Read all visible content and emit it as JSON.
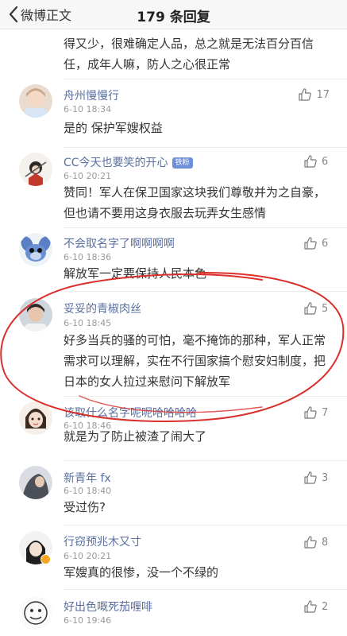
{
  "header": {
    "back_label": "微博正文",
    "title": "179 条回复"
  },
  "top_comment_text": "得又少，很难确定人品，总之就是无法百分百信任，成年人嘛，防人之心很正常",
  "comments": [
    {
      "name": "舟州慢慢行",
      "time": "6-10 18:34",
      "likes": "17",
      "text": "是的 保护军嫂权益"
    },
    {
      "name": "CC今天也要笑的开心",
      "badge": "铁粉",
      "time": "6-10 20:21",
      "likes": "6",
      "text": "赞同！军人在保卫国家这块我们尊敬并为之自豪，但也请不要用这身衣服去玩弄女生感情"
    },
    {
      "name": "不会取名字了啊啊啊啊",
      "time": "6-10 18:36",
      "likes": "6",
      "text": "解放军一定要保持人民本色"
    },
    {
      "name": "妥妥的青椒肉丝",
      "time": "6-10 18:45",
      "likes": "5",
      "text": "好多当兵的骚的可怕，毫不掩饰的那种，军人正常需求可以理解，实在不行国家搞个慰安妇制度，把日本的女人拉过来慰问下解放军"
    },
    {
      "name": "该取什么名字呢呢哈哈哈哈",
      "time": "6-10 18:46",
      "likes": "7",
      "text": "就是为了防止被渣了闹大了"
    },
    {
      "name": "新青年 fx",
      "time": "6-10 18:40",
      "likes": "3",
      "text": "受过伤?"
    },
    {
      "name": "行窃预兆木又寸",
      "time": "6-10 20:21",
      "likes": "8",
      "text": "军嫂真的很惨，没一个不绿的"
    },
    {
      "name": "好出色嘅死茄喱啡",
      "time": "6-10 19:46",
      "likes": "2",
      "text": ""
    }
  ],
  "icons": {
    "back": "chevron-left-icon",
    "like": "thumbs-up-icon"
  },
  "colors": {
    "username": "#5a6fa0",
    "annotation_circle": "#d9302c",
    "fan_badge": "#6f8fd8",
    "verified_badge": "#f5a623"
  }
}
